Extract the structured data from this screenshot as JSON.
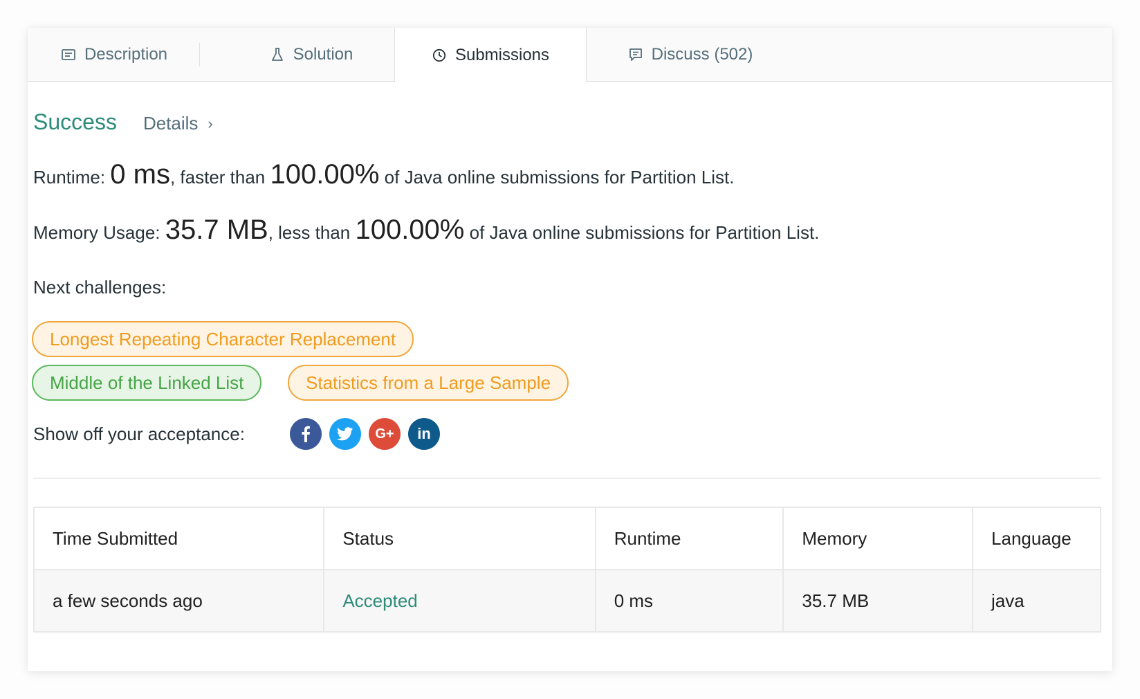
{
  "tabs": [
    {
      "label": "Description",
      "icon": "description-icon"
    },
    {
      "label": "Solution",
      "icon": "flask-icon"
    },
    {
      "label": "Submissions",
      "icon": "clock-icon",
      "active": true
    },
    {
      "label": "Discuss (502)",
      "icon": "comment-icon"
    }
  ],
  "result": {
    "status": "Success",
    "details_label": "Details",
    "runtime": {
      "label": "Runtime:",
      "value": "0 ms",
      "mid": ", faster than",
      "percent": "100.00%",
      "suffix": "of Java online submissions for Partition List."
    },
    "memory": {
      "label": "Memory Usage:",
      "value": "35.7 MB",
      "mid": ", less than",
      "percent": "100.00%",
      "suffix": "of Java online submissions for Partition List."
    }
  },
  "next_challenges": {
    "label": "Next challenges:",
    "items": [
      {
        "title": "Longest Repeating Character Replacement",
        "difficulty": "medium"
      },
      {
        "title": "Middle of the Linked List",
        "difficulty": "easy"
      },
      {
        "title": "Statistics from a Large Sample",
        "difficulty": "medium"
      }
    ]
  },
  "share": {
    "label": "Show off your acceptance:",
    "networks": [
      "facebook-icon",
      "twitter-icon",
      "google-plus-icon",
      "linkedin-icon"
    ]
  },
  "table": {
    "headers": [
      "Time Submitted",
      "Status",
      "Runtime",
      "Memory",
      "Language"
    ],
    "rows": [
      [
        "a few seconds ago",
        "Accepted",
        "0 ms",
        "35.7 MB",
        "java"
      ]
    ]
  },
  "colors": {
    "success": "#2e8c79",
    "medium": "#ef9b1f",
    "easy": "#47a447",
    "facebook": "#3b5998",
    "twitter": "#1da1f2",
    "google_plus": "#dd4b39",
    "linkedin": "#0e5a8a"
  }
}
